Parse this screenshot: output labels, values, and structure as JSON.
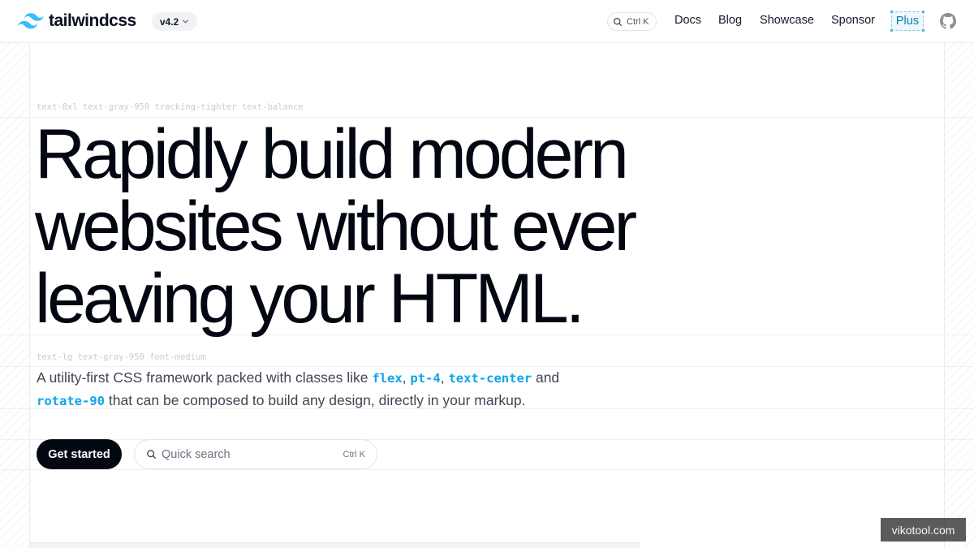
{
  "header": {
    "logo_text": "tailwindcss",
    "version": "v4.2",
    "search_shortcut": "Ctrl K",
    "nav": [
      "Docs",
      "Blog",
      "Showcase",
      "Sponsor"
    ],
    "plus_label": "Plus"
  },
  "hints": {
    "headline_classes": "text-8xl text-gray-950 tracking-tighter text-balance",
    "subtitle_classes": "text-lg text-gray-950 font-medium"
  },
  "hero": {
    "headline_lines": [
      "Rapidly build modern",
      "websites without ever",
      "leaving your HTML."
    ],
    "subtitle": {
      "part1": "A utility-first CSS framework packed with classes like ",
      "code1": "flex",
      "sep1": ", ",
      "code2": "pt-4",
      "sep2": ", ",
      "code3": "text-center",
      "part2": " and",
      "code4": "rotate-90",
      "part3": " that can be composed to build any design, directly in your markup."
    },
    "cta_label": "Get started",
    "quick_search_placeholder": "Quick search",
    "quick_search_shortcut": "Ctrl K"
  },
  "watermark": "vikotool.com",
  "icons": {
    "logo": "tailwind-logo-icon",
    "version_chevron": "chevron-down-icon",
    "search": "search-icon",
    "github": "github-icon"
  },
  "colors": {
    "brand": "#38bdf8",
    "code_accent": "#0ea5e9",
    "text": "#030712",
    "plus_border": "#7cc9e4"
  }
}
